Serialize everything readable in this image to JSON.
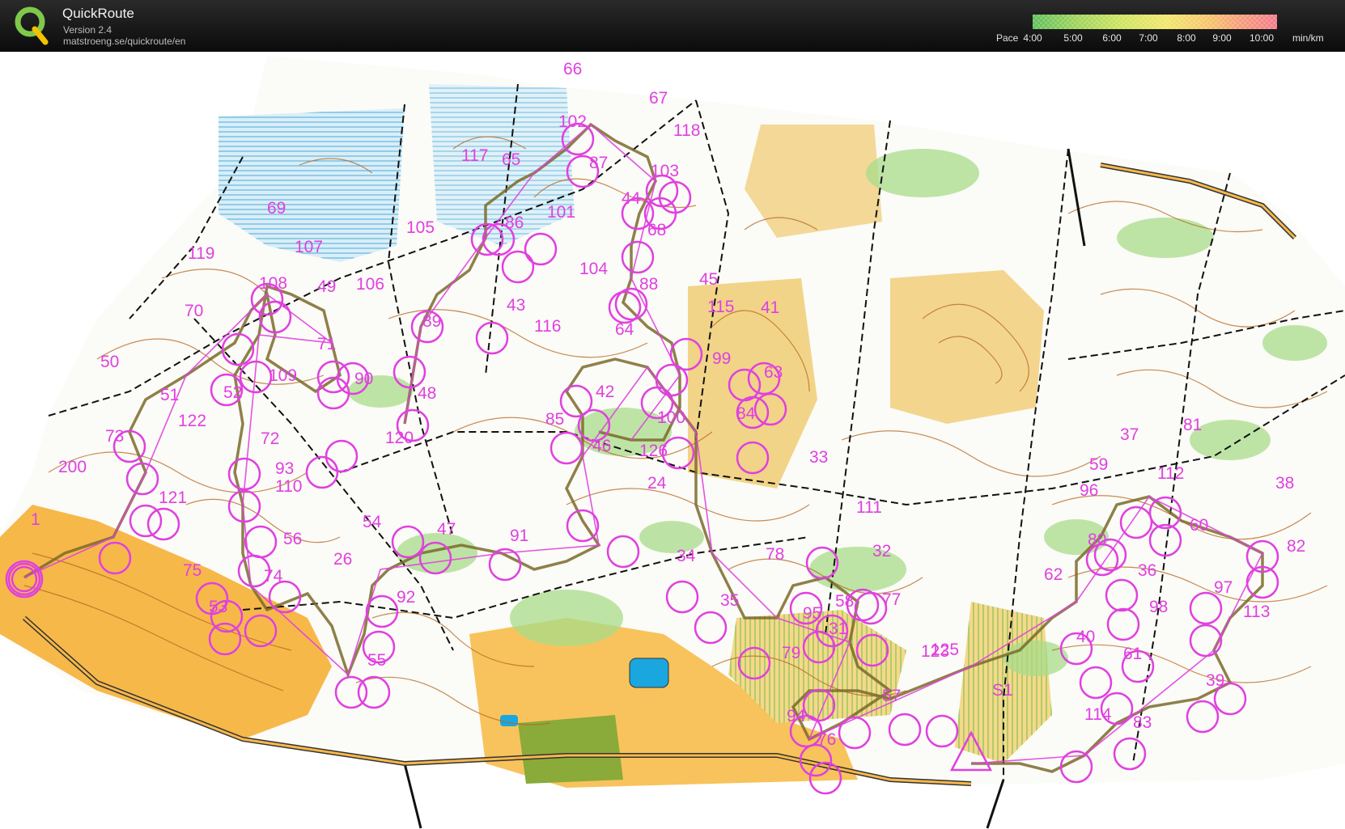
{
  "header": {
    "app_title": "QuickRoute",
    "version": "Version 2.4",
    "url": "matstroeng.se/quickroute/en",
    "pace_label": "Pace",
    "pace_unit": "min/km",
    "pace_ticks": [
      "4:00",
      "5:00",
      "6:00",
      "7:00",
      "8:00",
      "9:00",
      "10:00"
    ],
    "pace_colors": [
      "#5fbf5a",
      "#9ed35a",
      "#cde35e",
      "#f1e66a",
      "#f7c46a",
      "#f59a7a",
      "#f27a8a"
    ]
  },
  "map": {
    "route_color": "#7a6a2a",
    "course_color": "#e040e0",
    "controls": [
      "1",
      "24",
      "26",
      "31",
      "32",
      "33",
      "34",
      "35",
      "36",
      "37",
      "38",
      "39",
      "40",
      "41",
      "42",
      "43",
      "44",
      "45",
      "46",
      "47",
      "48",
      "49",
      "50",
      "51",
      "52",
      "53",
      "54",
      "55",
      "56",
      "57",
      "58",
      "59",
      "60",
      "61",
      "62",
      "63",
      "64",
      "65",
      "66",
      "67",
      "68",
      "69",
      "70",
      "71",
      "72",
      "73",
      "74",
      "75",
      "76",
      "77",
      "78",
      "79",
      "80",
      "81",
      "82",
      "83",
      "84",
      "85",
      "86",
      "87",
      "88",
      "89",
      "90",
      "91",
      "92",
      "93",
      "94",
      "95",
      "96",
      "97",
      "98",
      "99",
      "100",
      "101",
      "102",
      "103",
      "104",
      "105",
      "106",
      "107",
      "108",
      "109",
      "110",
      "111",
      "112",
      "113",
      "114",
      "115",
      "116",
      "117",
      "118",
      "119",
      "120",
      "121",
      "122",
      "123",
      "125",
      "126",
      "200"
    ],
    "finish_label": "S1"
  }
}
